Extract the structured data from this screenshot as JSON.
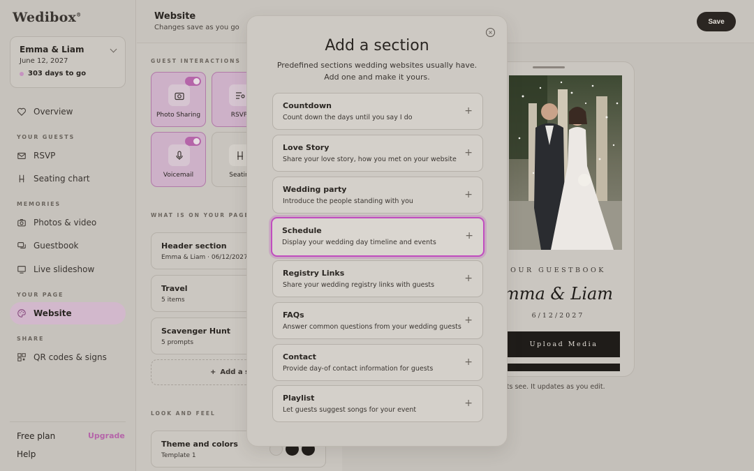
{
  "brand": {
    "logo": "Wedibox"
  },
  "couple": {
    "name": "Emma & Liam",
    "date": "June 12, 2027",
    "countdown": "303 days to go"
  },
  "sidebar": {
    "overview": "Overview",
    "sec_guests": "YOUR GUESTS",
    "rsvp": "RSVP",
    "seating": "Seating chart",
    "sec_memories": "MEMORIES",
    "photos": "Photos & video",
    "guestbook": "Guestbook",
    "slideshow": "Live slideshow",
    "sec_page": "YOUR PAGE",
    "website": "Website",
    "sec_share": "SHARE",
    "qr": "QR codes & signs",
    "plan": "Free plan",
    "upgrade": "Upgrade",
    "help": "Help"
  },
  "header": {
    "title": "Website",
    "subtitle": "Changes save as you go",
    "save": "Save"
  },
  "guest_interactions": {
    "label": "GUEST INTERACTIONS",
    "tiles": [
      "Photo Sharing",
      "RSVP",
      "Voicemail",
      "Seatin"
    ]
  },
  "on_page": {
    "label": "WHAT IS ON YOUR PAGE",
    "cards": [
      {
        "title": "Header section",
        "sub": "Emma & Liam · 06/12/2027"
      },
      {
        "title": "Travel",
        "sub": "5 items"
      },
      {
        "title": "Scavenger Hunt",
        "sub": "5 prompts"
      }
    ],
    "add": "Add a s"
  },
  "look_feel": {
    "label": "LOOK AND FEEL",
    "title": "Theme and colors",
    "sub": "Template 1"
  },
  "preview": {
    "guestbook": "OUR GUESTBOOK",
    "names": "mma & Liam",
    "date": "6/12/2027",
    "upload": "Upload Media",
    "caption": "ur guests see. It updates as you edit."
  },
  "modal": {
    "title": "Add a section",
    "description": "Predefined sections wedding websites usually have. Add one and make it yours.",
    "options": [
      {
        "title": "Countdown",
        "sub": "Count down the days until you say I do"
      },
      {
        "title": "Love Story",
        "sub": "Share your love story, how you met on your website"
      },
      {
        "title": "Wedding party",
        "sub": "Introduce the people standing with you"
      },
      {
        "title": "Schedule",
        "sub": "Display your wedding day timeline and events"
      },
      {
        "title": "Registry Links",
        "sub": "Share your wedding registry links with guests"
      },
      {
        "title": "FAQs",
        "sub": "Answer common questions from your wedding guests"
      },
      {
        "title": "Contact",
        "sub": "Provide day-of contact information for guests"
      },
      {
        "title": "Playlist",
        "sub": "Let guests suggest songs for your event"
      }
    ]
  },
  "colors": {
    "accent": "#b565a9",
    "highlight": "#c04dbf",
    "dark": "#2b2622"
  }
}
